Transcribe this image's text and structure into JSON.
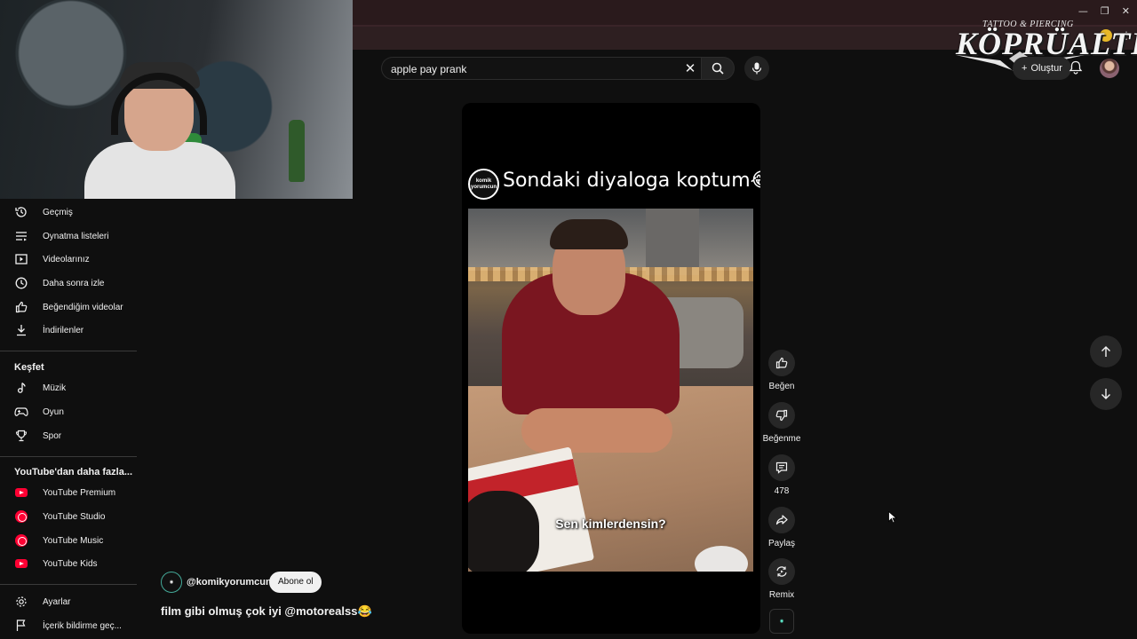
{
  "browser": {
    "window_controls": [
      "—",
      "❐",
      "✕"
    ]
  },
  "logo_overlay": {
    "top_text": "TATTOO & PIERCING",
    "main_text": "KÖPRÜALTI"
  },
  "masthead": {
    "search_value": "apple pay prank",
    "create_label": "Oluştur"
  },
  "sidebar": {
    "you_items": [
      {
        "label": "Geçmiş",
        "icon": "history-icon"
      },
      {
        "label": "Oynatma listeleri",
        "icon": "playlist-icon"
      },
      {
        "label": "Videolarınız",
        "icon": "your-videos-icon"
      },
      {
        "label": "Daha sonra izle",
        "icon": "clock-icon"
      },
      {
        "label": "Beğendiğim videolar",
        "icon": "thumbs-up-icon"
      },
      {
        "label": "İndirilenler",
        "icon": "download-icon"
      }
    ],
    "explore_header": "Keşfet",
    "explore_items": [
      {
        "label": "Müzik",
        "icon": "music-note-icon"
      },
      {
        "label": "Oyun",
        "icon": "gamepad-icon"
      },
      {
        "label": "Spor",
        "icon": "trophy-icon"
      }
    ],
    "more_header": "YouTube'dan daha fazla...",
    "more_items": [
      {
        "label": "YouTube Premium",
        "icon": "youtube-premium-icon"
      },
      {
        "label": "YouTube Studio",
        "icon": "youtube-studio-icon"
      },
      {
        "label": "YouTube Music",
        "icon": "youtube-music-icon"
      },
      {
        "label": "YouTube Kids",
        "icon": "youtube-kids-icon"
      }
    ],
    "bottom_items": [
      {
        "label": "Ayarlar",
        "icon": "settings-gear-icon"
      },
      {
        "label": "İçerik bildirme geç...",
        "icon": "flag-icon"
      }
    ]
  },
  "short": {
    "title": "Sondaki diyaloga koptum😂",
    "channel_avatar_text": "komik yorumcun",
    "subtitle": "Sen kimlerdensin?",
    "channel_handle": "@komikyorumcun",
    "subscribe_label": "Abone ol",
    "caption": "film gibi olmuş çok iyi @motorealss😂"
  },
  "actions": {
    "like_label": "Beğen",
    "dislike_label": "Beğenme",
    "comments_count": "478",
    "share_label": "Paylaş",
    "remix_label": "Remix"
  },
  "colors": {
    "background": "#0f0f0f",
    "youtube_red": "#ff0033",
    "button_bg": "#272727"
  }
}
